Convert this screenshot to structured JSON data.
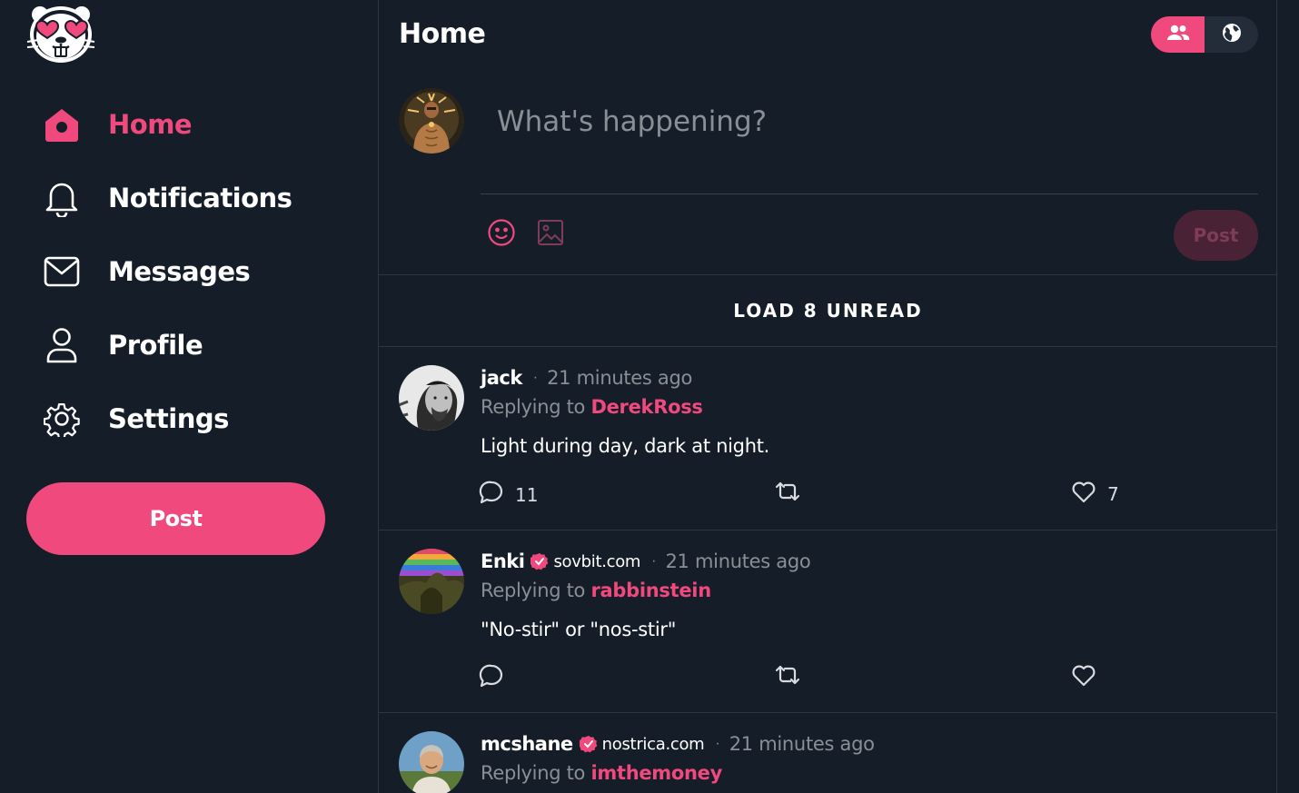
{
  "sidebar": {
    "nav": [
      {
        "label": "Home",
        "icon": "home-icon",
        "active": true
      },
      {
        "label": "Notifications",
        "icon": "bell-icon"
      },
      {
        "label": "Messages",
        "icon": "mail-icon"
      },
      {
        "label": "Profile",
        "icon": "user-icon"
      },
      {
        "label": "Settings",
        "icon": "gear-icon"
      }
    ],
    "post_label": "Post"
  },
  "header": {
    "title": "Home",
    "feed_toggle": [
      {
        "icon": "people-icon",
        "active": true
      },
      {
        "icon": "globe-icon",
        "active": false
      }
    ]
  },
  "composer": {
    "placeholder": "What's happening?",
    "post_label": "Post",
    "tools": [
      "emoji-icon",
      "image-icon"
    ]
  },
  "feed": {
    "load_unread": "LOAD 8 UNREAD",
    "posts": [
      {
        "author": "jack",
        "verified": false,
        "nip05": "",
        "time": "21 minutes ago",
        "reply_label": "Replying to",
        "reply_to": "DerekRoss",
        "content": "Light during day, dark at night.",
        "replies": "11",
        "reposts": "",
        "likes": "7"
      },
      {
        "author": "Enki",
        "verified": true,
        "nip05": "sovbit.com",
        "time": "21 minutes ago",
        "reply_label": "Replying to",
        "reply_to": "rabbinstein",
        "content": "\"No-stir\" or \"nos-stir\"",
        "replies": "",
        "reposts": "",
        "likes": ""
      },
      {
        "author": "mcshane",
        "verified": true,
        "nip05": "nostrica.com",
        "time": "21 minutes ago",
        "reply_label": "Replying to",
        "reply_to": "imthemoney",
        "content": "",
        "replies": "",
        "reposts": "",
        "likes": ""
      }
    ]
  },
  "colors": {
    "accent": "#f0497e",
    "background": "#151d28",
    "muted": "#8a8f96",
    "border": "#2e3642"
  }
}
